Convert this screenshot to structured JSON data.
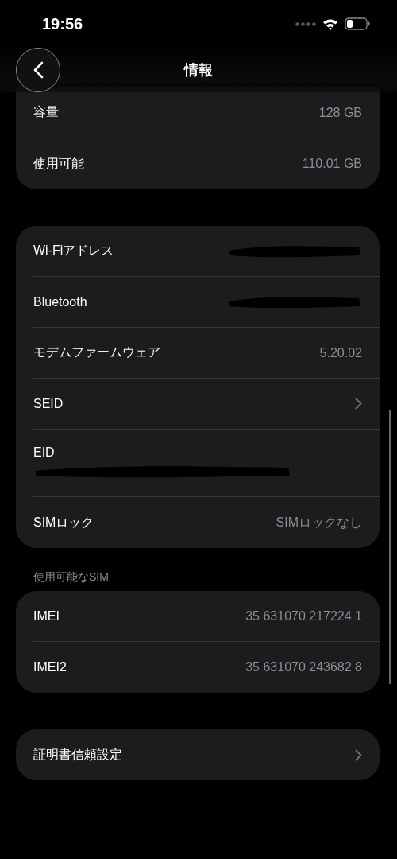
{
  "status_bar": {
    "time": "19:56"
  },
  "nav": {
    "title": "情報"
  },
  "groups": [
    {
      "rows": [
        {
          "kind": "value",
          "label": "容量",
          "value": "128 GB"
        },
        {
          "kind": "value",
          "label": "使用可能",
          "value": "110.01 GB"
        }
      ]
    },
    {
      "rows": [
        {
          "kind": "redacted",
          "label": "Wi-Fiアドレス"
        },
        {
          "kind": "redacted",
          "label": "Bluetooth"
        },
        {
          "kind": "value",
          "label": "モデムファームウェア",
          "value": "5.20.02"
        },
        {
          "kind": "chevron",
          "label": "SEID"
        },
        {
          "kind": "stacked_redacted",
          "label": "EID"
        },
        {
          "kind": "value",
          "label": "SIMロック",
          "value": "SIMロックなし"
        }
      ]
    },
    {
      "header": "使用可能なSIM",
      "rows": [
        {
          "kind": "value",
          "label": "IMEI",
          "value": "35 631070 217224 1"
        },
        {
          "kind": "value",
          "label": "IMEI2",
          "value": "35 631070 243682 8"
        }
      ]
    },
    {
      "rows": [
        {
          "kind": "chevron",
          "label": "証明書信頼設定"
        }
      ]
    }
  ]
}
